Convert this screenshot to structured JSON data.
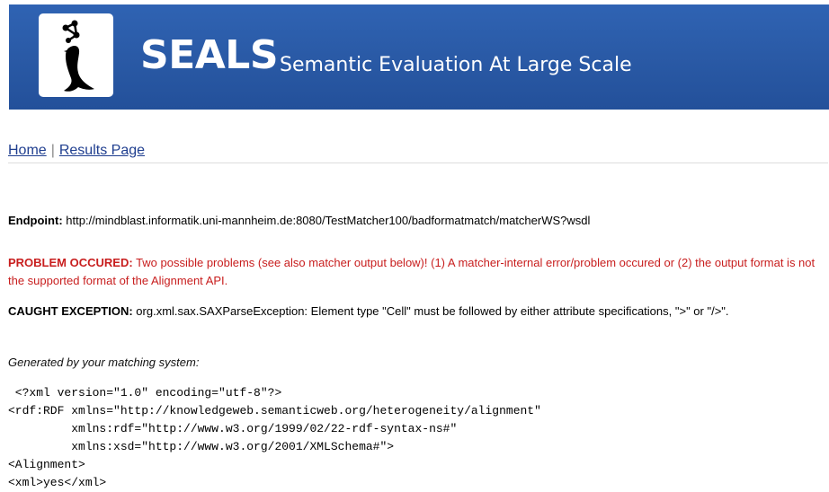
{
  "header": {
    "brand": "SEALS",
    "tagline": "Semantic Evaluation At Large Scale",
    "logo_icon": "seal-with-network-ball-icon",
    "background_color": "#2a5aa6"
  },
  "nav": {
    "home": "Home",
    "separator": "|",
    "results": "Results Page"
  },
  "endpoint": {
    "label": "Endpoint:",
    "value": "http://mindblast.informatik.uni-mannheim.de:8080/TestMatcher100/badformatmatch/matcherWS?wsdl"
  },
  "problem": {
    "label": "PROBLEM OCCURED:",
    "text": "Two possible problems (see also matcher output below)! (1) A matcher-internal error/problem occured or (2) the output format is not the supported format of the Alignment API.",
    "color": "#c81e1e"
  },
  "exception": {
    "label": "CAUGHT EXCEPTION:",
    "text": "org.xml.sax.SAXParseException: Element type \"Cell\" must be followed by either attribute specifications, \">\" or \"/>\"."
  },
  "generated_label": "Generated by your matching system:",
  "output_xml": " <?xml version=\"1.0\" encoding=\"utf-8\"?>\n<rdf:RDF xmlns=\"http://knowledgeweb.semanticweb.org/heterogeneity/alignment\"\n         xmlns:rdf=\"http://www.w3.org/1999/02/22-rdf-syntax-ns#\"\n         xmlns:xsd=\"http://www.w3.org/2001/XMLSchema#\">\n<Alignment>\n<xml>yes</xml>"
}
